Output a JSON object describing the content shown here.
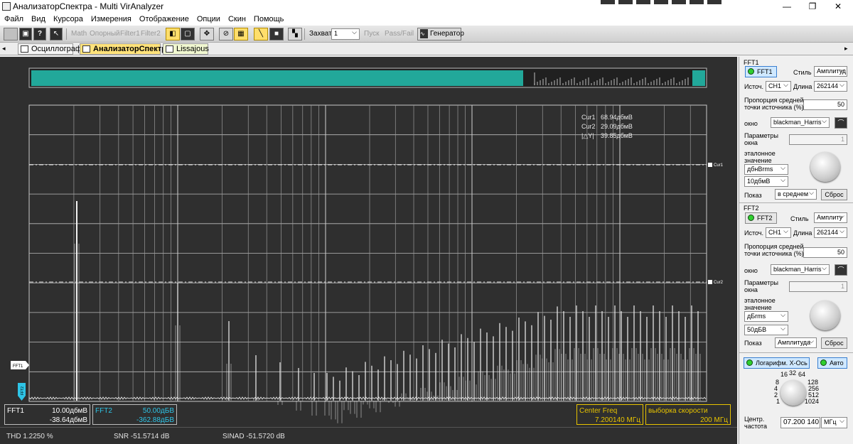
{
  "window": {
    "title": "АнализаторСпектра - Multi VirAnalyzer",
    "minimize_glyph": "—",
    "maximize_glyph": "❐",
    "close_glyph": "✕"
  },
  "menu": [
    "Файл",
    "Вид",
    "Курсора",
    "Измерения",
    "Отображение",
    "Опции",
    "Скин",
    "Помощь"
  ],
  "toolbar": {
    "math": "Math",
    "opornyi": "Опорный",
    "filter1": "Filter1",
    "filter2": "Filter2",
    "capture_label": "Захват",
    "capture_value": "1",
    "start": "Пуск",
    "passfail": "Pass/Fail",
    "generator": "Генератор",
    "help": "?"
  },
  "tabs": [
    "Осциллограф",
    "АнализаторСпектра",
    "Lissajous"
  ],
  "plot": {
    "cursor_readout": {
      "cur1_label": "Cur1",
      "cur1_value": "68.94дбмВ",
      "cur2_label": "Cur2",
      "cur2_value": "29.09дбмВ",
      "dy_label": "|△Y|",
      "dy_value": "39.85дбмВ"
    },
    "cur1_tag": "Cur1",
    "cur2_tag": "Cur2",
    "fft1_marker": "FFT1",
    "fft2_marker": "FFT2"
  },
  "chart_data": {
    "type": "line",
    "title": "",
    "xlabel": "",
    "ylabel": "",
    "x_scale": "log",
    "grid": true,
    "cursors": {
      "cur1": 68.94,
      "cur2": 29.09,
      "unit": "дбмВ"
    },
    "series": [
      {
        "color": "#ffffff"
      }
    ]
  },
  "bottom": {
    "fft1_label": "FFT1",
    "fft1_scale": "10.00дбмВ",
    "fft1_offset": "-38.64дбмВ",
    "fft2_label": "FFT2",
    "fft2_scale": "50.00дБВ",
    "fft2_offset": "-362.88дБВ",
    "center_freq_label": "Center Freq",
    "center_freq_value": "7.200140 МГц",
    "sample_rate_label": "выборка скорости",
    "sample_rate_value": "200 МГц",
    "thd": "THD  1.2250 %",
    "snr": "SNR  -51.5714 dB",
    "sinad": "SINAD  -51.5720 dB"
  },
  "colors": {
    "trace_teal": "#22a89a",
    "panel_bg": "#2f2f2f",
    "accent_yellow": "#e8c400",
    "fft2_cyan": "#2ec4e6"
  },
  "fft1": {
    "group_label": "FFT1",
    "toggle": "FFT1",
    "style_label": "Стиль",
    "style_value": "Амплитуд",
    "source_label": "Источ.",
    "source_value": "CH1",
    "length_label": "Длина",
    "length_value": "262144",
    "ratio_label1": "Пропорция средней",
    "ratio_label2": "точки источника (%)",
    "ratio_value": "50",
    "window_label": "окно",
    "window_value": "blackman_Harris",
    "params_label1": "Параметры",
    "params_label2": "окна",
    "params_value": "1",
    "ref_label1": "эталонное",
    "ref_label2": "значение",
    "ref_unit": "дбнВrms",
    "ref_value": "10дбмВ",
    "show_label": "Показ",
    "show_value": "в среднем",
    "reset": "Сброс"
  },
  "fft2": {
    "group_label": "FFT2",
    "toggle": "FFT2",
    "style_label": "Стиль",
    "style_value": "Амплиту",
    "source_label": "Источ.",
    "source_value": "CH1",
    "length_label": "Длина",
    "length_value": "262144",
    "ratio_label1": "Пропорция средней",
    "ratio_label2": "точки источника (%)",
    "ratio_value": "50",
    "window_label": "окно",
    "window_value": "blackman_Harris",
    "params_label1": "Параметры",
    "params_label2": "окна",
    "params_value": "1",
    "ref_label1": "эталонное",
    "ref_label2": "значение",
    "ref_unit": "дБrms",
    "ref_value": "50дБВ",
    "show_label": "Показ",
    "show_value": "Амплитуда",
    "reset": "Сброс"
  },
  "xaxis": {
    "log_button": "Логарифм. Х-Ось",
    "auto_button": "Авто",
    "dial_labels": [
      "16",
      "32",
      "64",
      "128",
      "256",
      "512",
      "1024",
      "1",
      "2",
      "4",
      "8"
    ],
    "center_label1": "Центр.",
    "center_label2": "частота",
    "center_value": "07.200 140",
    "center_unit": "МГц"
  }
}
